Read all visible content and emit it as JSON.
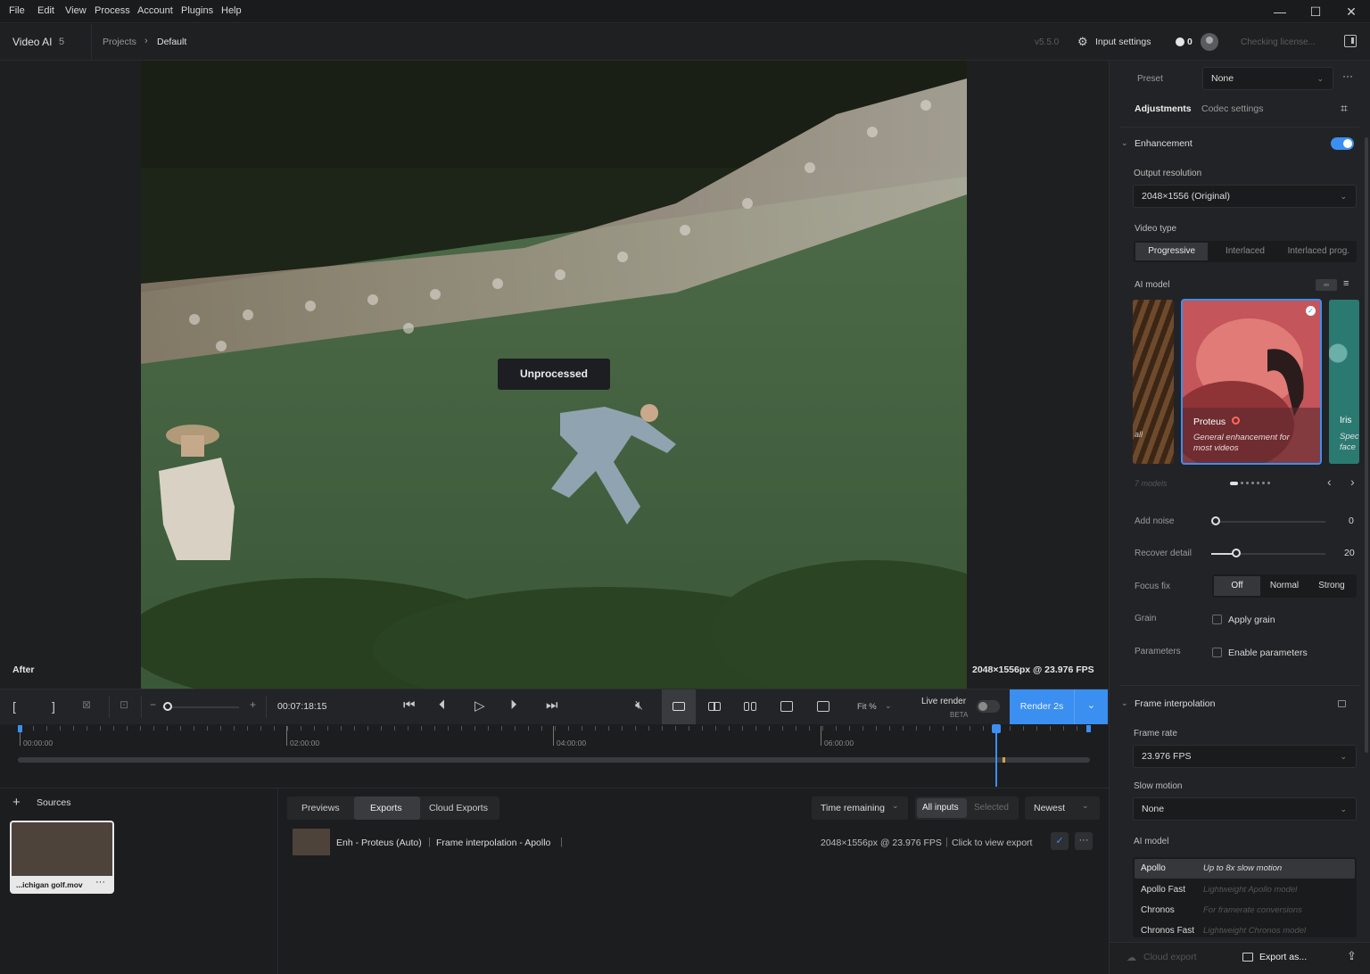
{
  "menu": [
    "File",
    "Edit",
    "View",
    "Process",
    "Account",
    "Plugins",
    "Help"
  ],
  "window_controls": {
    "minimize": "—",
    "maximize": "☐",
    "close": "✕"
  },
  "header": {
    "app_name": "Video AI",
    "app_version_major": "5",
    "breadcrumb": {
      "root": "Projects",
      "current": "Default"
    },
    "version": "v5.5.0",
    "input_settings": "Input settings",
    "credits": "0",
    "license_status": "Checking license..."
  },
  "viewer": {
    "overlay_label": "Unprocessed",
    "view_label": "After",
    "resolution_info": "2048×1556px @ 23.976 FPS"
  },
  "controls": {
    "timecode": "00:07:18:15",
    "zoom_label": "Fit %",
    "live_render_label": "Live render",
    "live_render_badge": "BETA",
    "render_button": "Render 2s"
  },
  "timeline": {
    "marks": [
      "00:00:00",
      "02:00:00",
      "04:00:00",
      "06:00:00"
    ]
  },
  "sources": {
    "title": "Sources",
    "items": [
      {
        "name": "...ichigan golf.mov"
      }
    ]
  },
  "exports": {
    "tabs": [
      "Previews",
      "Exports",
      "Cloud Exports"
    ],
    "active_tab": "Exports",
    "sort_dropdown": "Time remaining",
    "filter": [
      "All inputs",
      "Selected"
    ],
    "order_dropdown": "Newest",
    "rows": [
      {
        "enhancement": "Enh - Proteus (Auto)",
        "interpolation": "Frame interpolation - Apollo",
        "info": "2048×1556px @ 23.976 FPS",
        "action": "Click to view export"
      }
    ]
  },
  "panel": {
    "preset_label": "Preset",
    "preset_value": "None",
    "tabs": [
      "Adjustments",
      "Codec settings"
    ],
    "enhancement": {
      "title": "Enhancement",
      "enabled": true,
      "output_resolution_label": "Output resolution",
      "output_resolution_value": "2048×1556 (Original)",
      "video_type_label": "Video type",
      "video_types": [
        "Progressive",
        "Interlaced",
        "Interlaced prog."
      ],
      "video_type_selected": "Progressive",
      "ai_model_label": "AI model",
      "model_count": "7 models",
      "models": [
        {
          "name": "Proteus",
          "desc": "General enhancement for most videos",
          "selected": true
        },
        {
          "name": "Iris",
          "desc": "Spec face"
        }
      ],
      "left_card_desc": "all",
      "add_noise_label": "Add noise",
      "add_noise_value": 0,
      "recover_detail_label": "Recover detail",
      "recover_detail_value": 20,
      "focus_fix_label": "Focus fix",
      "focus_fix_options": [
        "Off",
        "Normal",
        "Strong"
      ],
      "focus_fix_selected": "Off",
      "grain_label": "Grain",
      "grain_checkbox": "Apply grain",
      "parameters_label": "Parameters",
      "parameters_checkbox": "Enable parameters"
    },
    "frame_interpolation": {
      "title": "Frame interpolation",
      "frame_rate_label": "Frame rate",
      "frame_rate_value": "23.976 FPS",
      "slow_motion_label": "Slow motion",
      "slow_motion_value": "None",
      "ai_model_label": "AI model",
      "models": [
        {
          "name": "Apollo",
          "desc": "Up to 8x slow motion",
          "selected": true
        },
        {
          "name": "Apollo Fast",
          "desc": "Lightweight Apollo model"
        },
        {
          "name": "Chronos",
          "desc": "For framerate conversions"
        },
        {
          "name": "Chronos Fast",
          "desc": "Lightweight Chronos model"
        }
      ]
    },
    "footer": {
      "cloud_export": "Cloud export",
      "export_as": "Export as..."
    }
  }
}
